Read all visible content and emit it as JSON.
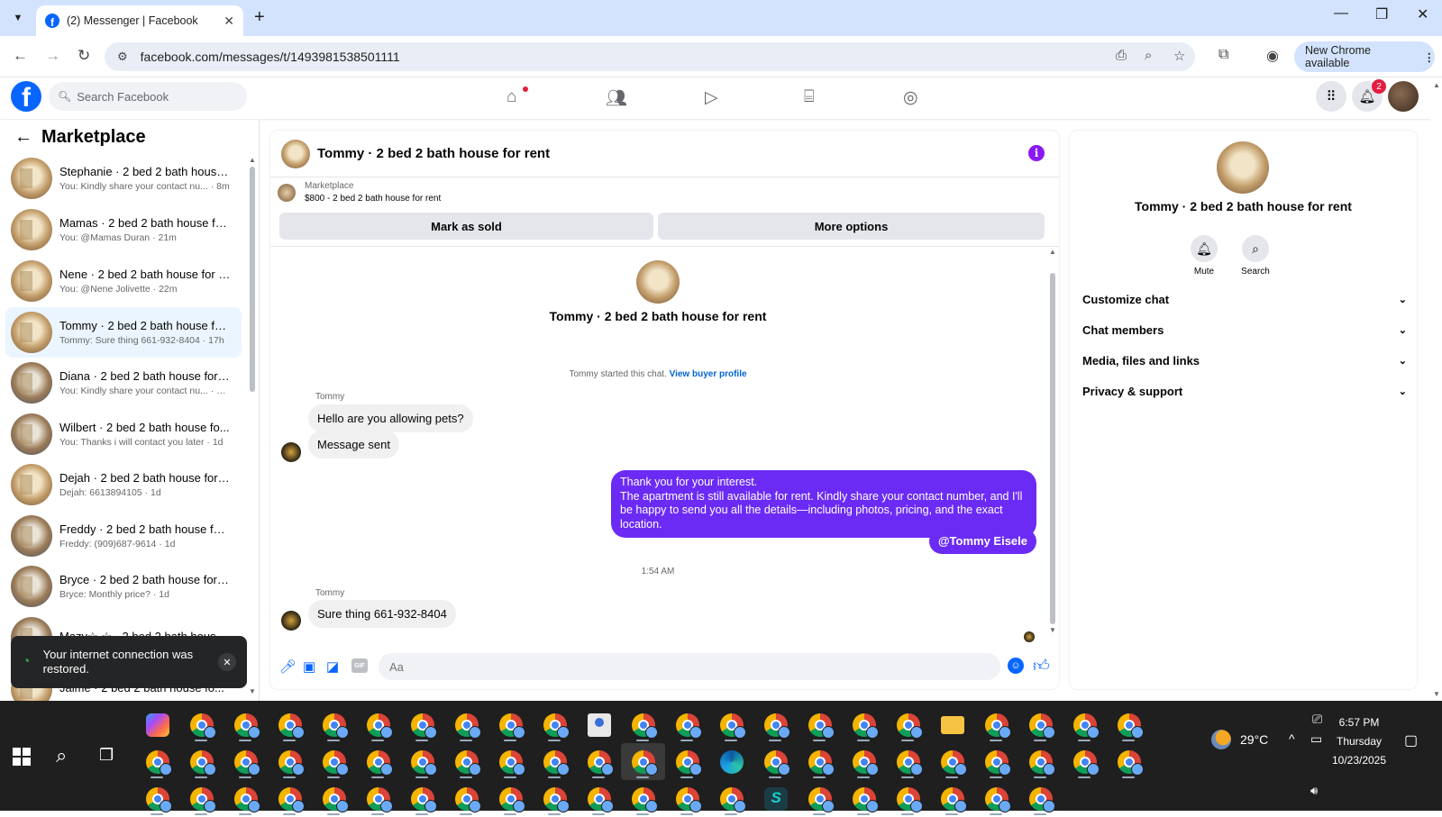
{
  "browser": {
    "tab_title": "(2) Messenger | Facebook",
    "url": "facebook.com/messages/t/1493981538501111",
    "new_chrome_label": "New Chrome available"
  },
  "fb": {
    "search_placeholder": "Search Facebook",
    "notification_count": "2"
  },
  "sidebar": {
    "title": "Marketplace",
    "conversations": [
      {
        "name": "Stephanie · 2 bed 2 bath house ...",
        "preview": "You: Kindly share your contact nu... · 8m"
      },
      {
        "name": "Mamas · 2 bed 2 bath house for...",
        "preview": "You: @Mamas Duran · 21m"
      },
      {
        "name": "Nene · 2 bed 2 bath house for r...",
        "preview": "You: @Nene Jolivette · 22m"
      },
      {
        "name": "Tommy · 2 bed 2 bath house for...",
        "preview": "Tommy: Sure thing 661-932-8404 · 17h"
      },
      {
        "name": "Diana · 2 bed 2 bath house for r...",
        "preview": "You: Kindly share your contact nu... · 22h"
      },
      {
        "name": "Wilbert · 2 bed 2 bath house fo...",
        "preview": "You: Thanks i will contact you later · 1d"
      },
      {
        "name": "Dejah · 2 bed 2 bath house for r...",
        "preview": "Dejah: 6613894105 · 1d"
      },
      {
        "name": "Freddy · 2 bed 2 bath house for...",
        "preview": "Freddy: (909)687-9614 · 1d"
      },
      {
        "name": "Bryce · 2 bed 2 bath house for r...",
        "preview": "Bryce: Monthly price? · 1d"
      },
      {
        "name": "Mazy☆ ☆ · 2 bed 2 bath house...",
        "preview": ""
      },
      {
        "name": "Jaime · 2 bed 2 bath house fo...",
        "preview": ""
      }
    ],
    "toast": "Your internet connection was restored."
  },
  "chat": {
    "title": "Tommy · 2 bed 2 bath house for rent",
    "marketplace_label": "Marketplace",
    "listing": "$800 - 2 bed 2 bath house for rent",
    "mark_sold": "Mark as sold",
    "more_options": "More options",
    "profile_title": "Tommy · 2 bed 2 bath house for rent",
    "started_text": "Tommy started this chat.",
    "view_profile": "View buyer profile",
    "messages": [
      {
        "sender": "Tommy",
        "text": "Hello are you allowing pets?"
      },
      {
        "text": "Message sent"
      },
      {
        "out": "Thank you for your interest.\nThe apartment is still available for rent. Kindly share your contact number, and I'll be happy to send you all the details—including photos, pricing, and the exact location."
      },
      {
        "out": "@Tommy Eisele"
      },
      {
        "time": "1:54 AM"
      },
      {
        "sender": "Tommy",
        "text": "Sure thing 661-932-8404"
      }
    ],
    "input_placeholder": "Aa",
    "gif_label": "GIF"
  },
  "right_panel": {
    "title": "Tommy · 2 bed 2 bath house for rent",
    "mute": "Mute",
    "search": "Search",
    "sections": [
      "Customize chat",
      "Chat members",
      "Media, files and links",
      "Privacy & support"
    ]
  },
  "taskbar": {
    "temperature": "29°C",
    "time": "6:57 PM",
    "day": "Thursday",
    "date": "10/23/2025"
  }
}
